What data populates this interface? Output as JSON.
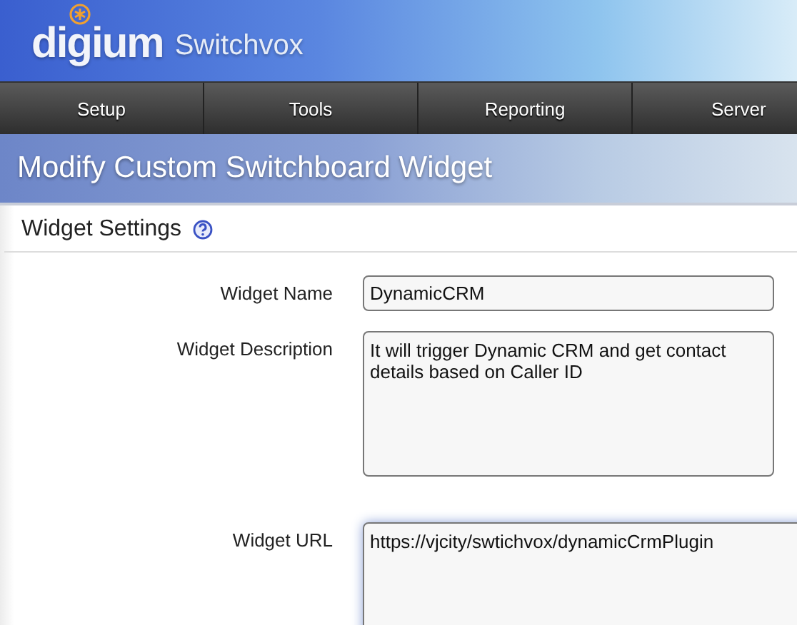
{
  "header": {
    "logo": "digium",
    "product": "Switchvox"
  },
  "nav": [
    {
      "label": "Setup"
    },
    {
      "label": "Tools"
    },
    {
      "label": "Reporting"
    },
    {
      "label": "Server"
    }
  ],
  "page_title": "Modify Custom Switchboard Widget",
  "section": {
    "title": "Widget Settings"
  },
  "fields": [
    {
      "kind": "input",
      "label": "Widget Name",
      "value": "DynamicCRM",
      "focused": false
    },
    {
      "kind": "textarea",
      "label": "Widget Description",
      "value": "It will trigger Dynamic CRM and get contact details based on Caller ID",
      "focused": false
    },
    {
      "kind": "textarea",
      "label": "Widget URL",
      "value": "https://vjcity/swtichvox/dynamicCrmPlugin",
      "focused": true
    }
  ]
}
